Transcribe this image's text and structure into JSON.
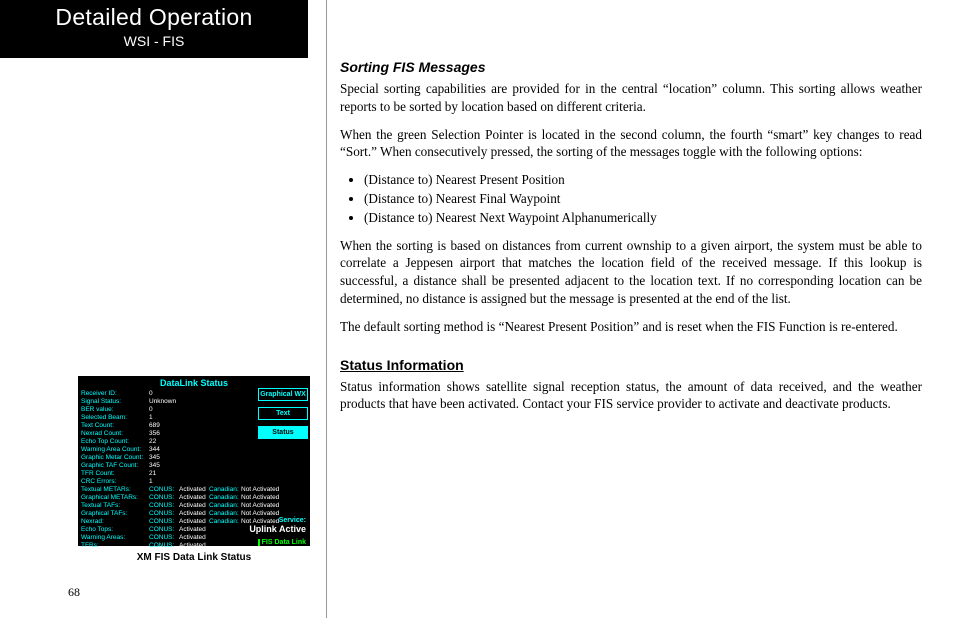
{
  "header": {
    "title": "Detailed Operation",
    "subtitle": "WSI - FIS"
  },
  "page_number": "68",
  "section1": {
    "title": "Sorting FIS Messages",
    "p1": "Special sorting capabilities are provided for in the central “location” column. This sorting allows weather reports to be sorted by location based on different criteria.",
    "p2": "When the green Selection Pointer is located in the second column, the fourth “smart” key changes to read “Sort.” When consecutively pressed, the sorting of the messages toggle with the following options:",
    "bullets": [
      "(Distance to) Nearest Present Position",
      "(Distance to) Nearest Final Waypoint",
      "(Distance to) Nearest Next Waypoint Alphanumerically"
    ],
    "p3": "When the sorting is based on distances from current ownship to a given airport, the system must be able to correlate a Jeppesen airport that matches the location field of the received message. If this lookup is successful, a distance shall be presented adjacent to the location text. If no corresponding location can be determined, no distance is assigned but the message is presented at the end of the list.",
    "p4": "The default sorting method is “Nearest Present Position” and is reset when the FIS Function is re-entered."
  },
  "section2": {
    "title": "Status Information",
    "p1": "Status information shows satellite signal reception status, the amount of data received, and the weather products that have been activated. Contact your FIS service provider to activate and deactivate products."
  },
  "figure": {
    "title": "DataLink Status",
    "caption": "XM FIS Data Link Status",
    "tabs": [
      "Graphical WX",
      "Text",
      "Status"
    ],
    "service_label": "Service:",
    "service_value": "Uplink Active",
    "footer_tab": "FIS Data Link",
    "rows_top": [
      {
        "label": "Receiver ID:",
        "value": "0"
      },
      {
        "label": "Signal Status:",
        "value": "Unknown"
      },
      {
        "label": "BER value:",
        "value": "0"
      },
      {
        "label": "Selected Beam:",
        "value": "1"
      },
      {
        "label": "Text Count:",
        "value": "689"
      },
      {
        "label": "Nexrad Count:",
        "value": "356"
      },
      {
        "label": "Echo Top Count:",
        "value": "22"
      },
      {
        "label": "Warning Area Count:",
        "value": "344"
      },
      {
        "label": "Graphic Metar Count:",
        "value": "345"
      },
      {
        "label": "Graphic TAF Count:",
        "value": "345"
      },
      {
        "label": "TFR Count:",
        "value": "21"
      },
      {
        "label": "CRC Errors:",
        "value": "1"
      }
    ],
    "rows_bottom": [
      {
        "label": "Textual METARs:",
        "c1l": "CONUS:",
        "c1v": "Activated",
        "c2l": "Canadian:",
        "c2v": "Not Activated"
      },
      {
        "label": "Graphical METARs:",
        "c1l": "CONUS:",
        "c1v": "Activated",
        "c2l": "Canadian:",
        "c2v": "Not Activated"
      },
      {
        "label": "Textual TAFs:",
        "c1l": "CONUS:",
        "c1v": "Activated",
        "c2l": "Canadian:",
        "c2v": "Not Activated"
      },
      {
        "label": "Graphical TAFs:",
        "c1l": "CONUS:",
        "c1v": "Activated",
        "c2l": "Canadian:",
        "c2v": "Not Activated"
      },
      {
        "label": "Nexrad:",
        "c1l": "CONUS:",
        "c1v": "Activated",
        "c2l": "Canadian:",
        "c2v": "Not Activated"
      },
      {
        "label": "Echo Tops:",
        "c1l": "CONUS:",
        "c1v": "Activated",
        "c2l": "",
        "c2v": ""
      },
      {
        "label": "Warning Areas:",
        "c1l": "CONUS:",
        "c1v": "Activated",
        "c2l": "",
        "c2v": ""
      },
      {
        "label": "TFRs:",
        "c1l": "CONUS:",
        "c1v": "Activated",
        "c2l": "",
        "c2v": ""
      }
    ]
  }
}
